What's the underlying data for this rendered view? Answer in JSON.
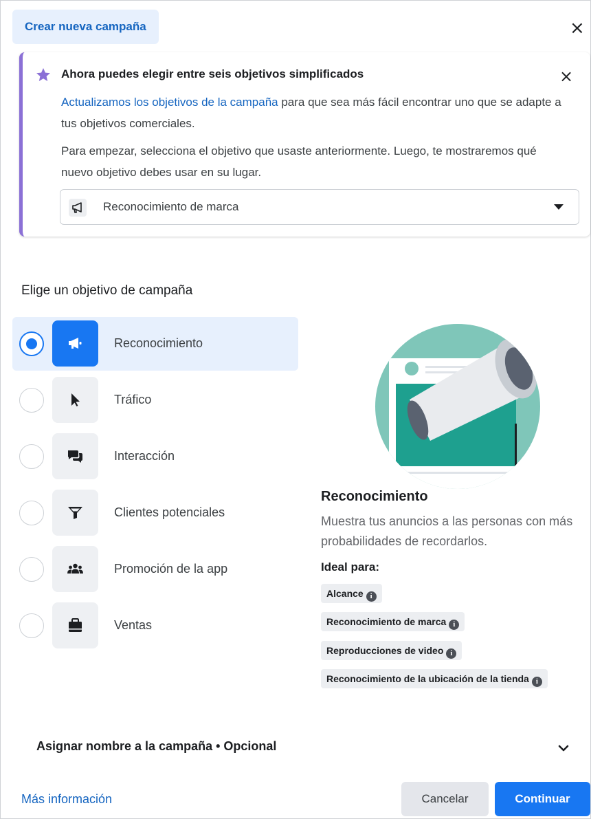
{
  "dialog": {
    "title": "Crear nueva campaña",
    "close_symbol": "×"
  },
  "banner": {
    "title": "Ahora puedes elegir entre seis objetivos simplificados",
    "p1_link": "Actualizamos los objetivos de la campaña",
    "p1_rest": " para que sea más fácil encontrar uno que se adapte a tus objetivos comerciales.",
    "p2": "Para empezar, selecciona el objetivo que usaste anteriormente. Luego, te mostraremos qué nuevo objetivo debes usar en su lugar.",
    "select_value": "Reconocimiento de marca",
    "close_symbol": "×",
    "accent_color": "#8b70d6"
  },
  "objectives": {
    "heading": "Elige un objetivo de campaña",
    "items": [
      {
        "label": "Reconocimiento",
        "icon": "megaphone-icon",
        "selected": true
      },
      {
        "label": "Tráfico",
        "icon": "cursor-icon",
        "selected": false
      },
      {
        "label": "Interacción",
        "icon": "chat-bubbles-icon",
        "selected": false
      },
      {
        "label": "Clientes potenciales",
        "icon": "filter-icon",
        "selected": false
      },
      {
        "label": "Promoción de la app",
        "icon": "people-icon",
        "selected": false
      },
      {
        "label": "Ventas",
        "icon": "shopping-bag-icon",
        "selected": false
      }
    ]
  },
  "detail": {
    "title": "Reconocimiento",
    "description": "Muestra tus anuncios a las personas con más probabilidades de recordarlos.",
    "ideal_label": "Ideal para:",
    "chips": [
      "Alcance",
      "Reconocimiento de marca",
      "Reproducciones de video",
      "Reconocimiento de la ubicación de la tienda"
    ]
  },
  "campaign_name": {
    "label": "Asignar nombre a la campaña • Opcional"
  },
  "footer": {
    "more_info": "Más información",
    "cancel": "Cancelar",
    "continue": "Continuar"
  },
  "colors": {
    "primary": "#1877f2",
    "link": "#1565c0",
    "selected_bg": "#e7f0fd"
  }
}
